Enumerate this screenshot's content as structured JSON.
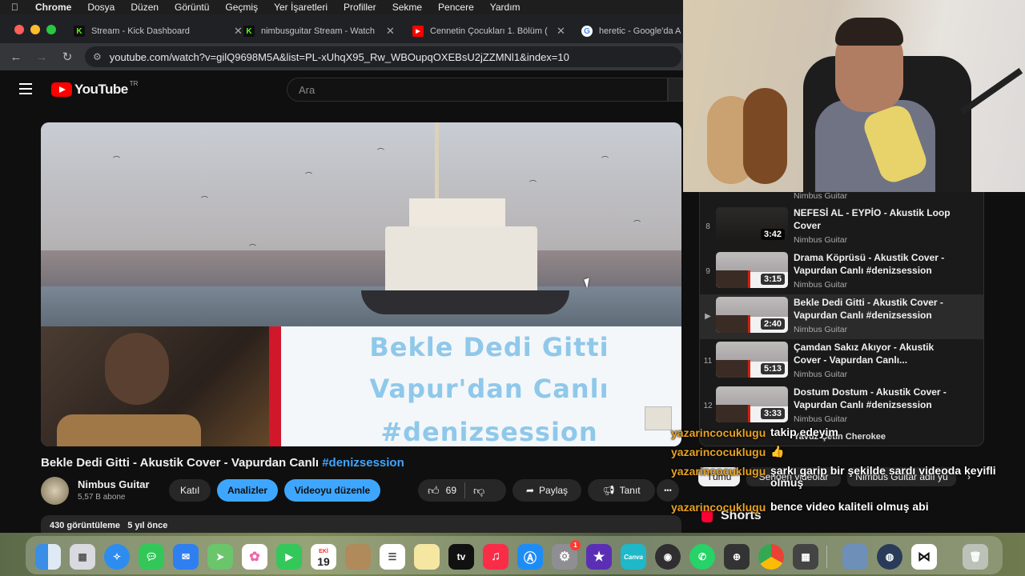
{
  "menubar": {
    "apple": "",
    "items": [
      "Chrome",
      "Dosya",
      "Düzen",
      "Görüntü",
      "Geçmiş",
      "Yer İşaretleri",
      "Profiller",
      "Sekme",
      "Pencere",
      "Yardım"
    ]
  },
  "tabs": [
    {
      "title": "Stream - Kick Dashboard",
      "icon": "kick-icon",
      "color": "#53fc18"
    },
    {
      "title": "nimbusguitar Stream - Watch",
      "icon": "kick-icon",
      "color": "#53fc18"
    },
    {
      "title": "Cennetin Çocukları 1. Bölüm (",
      "icon": "youtube-icon",
      "color": "#ff0000"
    },
    {
      "title": "heretic - Google'da A",
      "icon": "google-icon",
      "color": "#4285f4"
    }
  ],
  "address": {
    "url": "youtube.com/watch?v=gilQ9698M5A&list=PL-xUhqX95_Rw_WBOupqOXEBsU2jZZMNl1&index=10"
  },
  "youtube": {
    "logo_text": "YouTube",
    "country": "TR",
    "search_placeholder": "Ara"
  },
  "video": {
    "overlay_line1": "Bekle Dedi Gitti",
    "overlay_line2": "Vapur'dan Canlı",
    "overlay_line3": "#denizsession",
    "title": "Bekle Dedi Gitti - Akustik Cover - Vapurdan Canlı",
    "title_tag": "#denizsession",
    "channel": "Nimbus Guitar",
    "subscribers": "5,57 B abone",
    "join_label": "Katıl",
    "analytics_label": "Analizler",
    "edit_label": "Videoyu düzenle",
    "likes": "69",
    "share_label": "Paylaş",
    "promote_label": "Tanıt",
    "more_label": "•••",
    "views": "430 görüntüleme",
    "age": "5 yıl önce"
  },
  "playlist": {
    "top_channel": "Nimbus Guitar",
    "items": [
      {
        "index": "8",
        "title": "NEFESİ AL - EYPİO - Akustik Loop Cover",
        "channel": "Nimbus Guitar",
        "duration": "3:42",
        "active": false
      },
      {
        "index": "9",
        "title": "Drama Köprüsü - Akustik Cover - Vapurdan Canlı #denizsession",
        "channel": "Nimbus Guitar",
        "duration": "3:15",
        "active": false
      },
      {
        "index": "▶",
        "title": "Bekle Dedi Gitti - Akustik Cover - Vapurdan Canlı #denizsession",
        "channel": "Nimbus Guitar",
        "duration": "2:40",
        "active": true
      },
      {
        "index": "11",
        "title": "Çamdan Sakız Akıyor - Akustik Cover - Vapurdan Canlı...",
        "channel": "Nimbus Guitar",
        "duration": "5:13",
        "active": false
      },
      {
        "index": "12",
        "title": "Dostum Dostum - Akustik Cover - Vapurdan Canlı #denizsession",
        "channel": "Nimbus Guitar",
        "duration": "3:33",
        "active": false
      }
    ],
    "partial_channel": "Yavuz Çetin Cherokee"
  },
  "chips": [
    "Tümü",
    "Seriden videolar",
    "Nimbus Guitar adlı yü"
  ],
  "shorts_label": "Shorts",
  "chat": [
    {
      "user": "yazarincocuklugu",
      "message": "takip edeyim"
    },
    {
      "user": "yazarincocuklugu",
      "message": "👍"
    },
    {
      "user": "yazarincocuklugu",
      "message": "şarkı garip bir şekilde sardı videoda keyifli olmuş"
    },
    {
      "user": "yazarincocuklugu",
      "message": "bence video kaliteli olmuş abi"
    }
  ],
  "dock": {
    "calendar_month": "EKİ",
    "calendar_day": "19",
    "settings_badge": "1",
    "appletv_label": "tv",
    "canva_label": "Canva",
    "apps": [
      "finder-icon",
      "launchpad-icon",
      "safari-icon",
      "messages-icon",
      "mail-icon",
      "maps-icon",
      "photos-icon",
      "facetime-icon",
      "calendar-icon",
      "contacts-icon",
      "reminders-icon",
      "notes-icon",
      "appletv-icon",
      "music-icon",
      "appstore-icon",
      "settings-icon",
      "imovie-icon",
      "canva-icon",
      "obs-icon",
      "whatsapp-icon",
      "screenshot-icon",
      "chrome-icon",
      "calculator-icon",
      "preview-icon",
      "proxyman-icon",
      "capcut-icon",
      "trash-icon"
    ]
  }
}
